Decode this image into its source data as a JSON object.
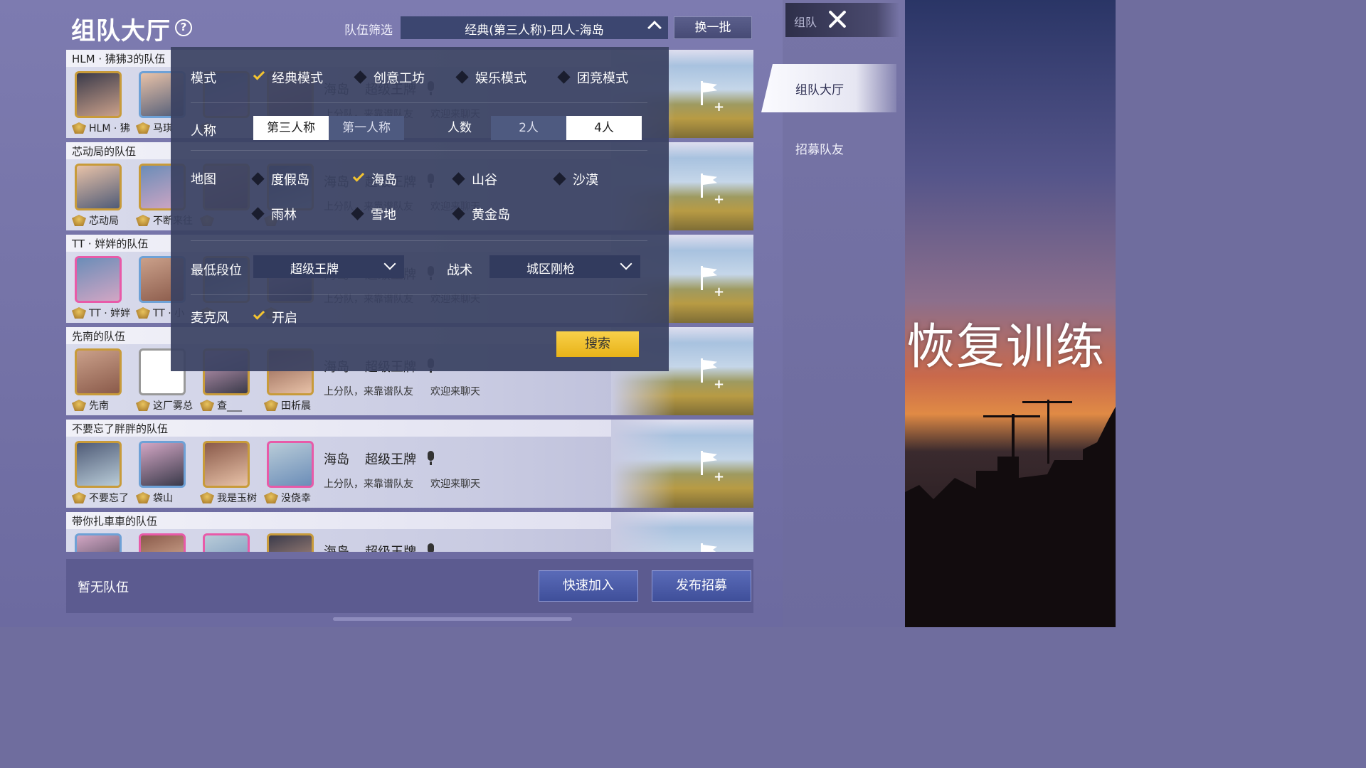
{
  "header": {
    "title": "组队大厅",
    "filter_label": "队伍筛选",
    "filter_value": "经典(第三人称)-四人-海岛",
    "refresh_label": "换一批"
  },
  "side": {
    "top_label": "组队",
    "tabs": [
      {
        "label": "组队大厅",
        "active": true
      },
      {
        "label": "招募队友",
        "active": false
      }
    ]
  },
  "overlay_text": "恢复训练",
  "teams": [
    {
      "name": "HLM · 狒狒3的队伍",
      "members": [
        "HLM · 狒",
        "马琪",
        "",
        ""
      ],
      "map": "海岛",
      "rank": "超级王牌",
      "tags": [
        "上分队，来靠谱队友",
        "欢迎来聊天"
      ]
    },
    {
      "name": "芯动局的队伍",
      "members": [
        "芯动局",
        "不断来往",
        "",
        ""
      ],
      "map": "海岛",
      "rank": "超级王牌",
      "tags": [
        "上分队，来靠谱队友",
        "欢迎来聊天"
      ]
    },
    {
      "name": "TT · 姅姅的队伍",
      "members": [
        "TT · 姅姅",
        "TT · 小",
        "",
        ""
      ],
      "map": "海岛",
      "rank": "超级王牌",
      "tags": [
        "上分队，来靠谱队友",
        "欢迎来聊天"
      ]
    },
    {
      "name": "先南的队伍",
      "members": [
        "先南",
        "这厂雾总",
        "查___",
        "田析晨"
      ],
      "map": "海岛",
      "rank": "超级王牌",
      "tags": [
        "上分队，来靠谱队友",
        "欢迎来聊天"
      ]
    },
    {
      "name": "不要忘了胖胖的队伍",
      "members": [
        "不要忘了",
        "袋山",
        "我是玉树",
        "没侥幸"
      ],
      "map": "海岛",
      "rank": "超级王牌",
      "tags": [
        "上分队，来靠谱队友",
        "欢迎来聊天"
      ]
    },
    {
      "name": "带你扎車車的队伍",
      "members": [
        "",
        "",
        "",
        ""
      ],
      "map": "海岛",
      "rank": "超级王牌",
      "tags": [
        "",
        ""
      ]
    }
  ],
  "filter_panel": {
    "mode_label": "模式",
    "modes": [
      {
        "label": "经典模式",
        "selected": true
      },
      {
        "label": "创意工坊",
        "selected": false
      },
      {
        "label": "娱乐模式",
        "selected": false
      },
      {
        "label": "团竞模式",
        "selected": false
      }
    ],
    "perspective_label": "人称",
    "perspectives": [
      {
        "label": "第三人称",
        "selected": true
      },
      {
        "label": "第一人称",
        "selected": false
      }
    ],
    "players_label": "人数",
    "players": [
      {
        "label": "2人",
        "selected": false
      },
      {
        "label": "4人",
        "selected": true
      }
    ],
    "map_label": "地图",
    "maps": [
      {
        "label": "度假岛",
        "selected": false
      },
      {
        "label": "海岛",
        "selected": true
      },
      {
        "label": "山谷",
        "selected": false
      },
      {
        "label": "沙漠",
        "selected": false
      },
      {
        "label": "雨林",
        "selected": false
      },
      {
        "label": "雪地",
        "selected": false
      },
      {
        "label": "黄金岛",
        "selected": false
      }
    ],
    "min_rank_label": "最低段位",
    "min_rank_value": "超级王牌",
    "tactic_label": "战术",
    "tactic_value": "城区刚枪",
    "mic_label": "麦克风",
    "mic_option": "开启",
    "search_label": "搜索"
  },
  "bottom": {
    "empty_text": "暂无队伍",
    "quick_join_label": "快速加入",
    "publish_label": "发布招募"
  },
  "colors": {
    "accent_yellow": "#f4c430",
    "panel_bg": "#3a4262",
    "button_blue": "#4a5aa8"
  }
}
